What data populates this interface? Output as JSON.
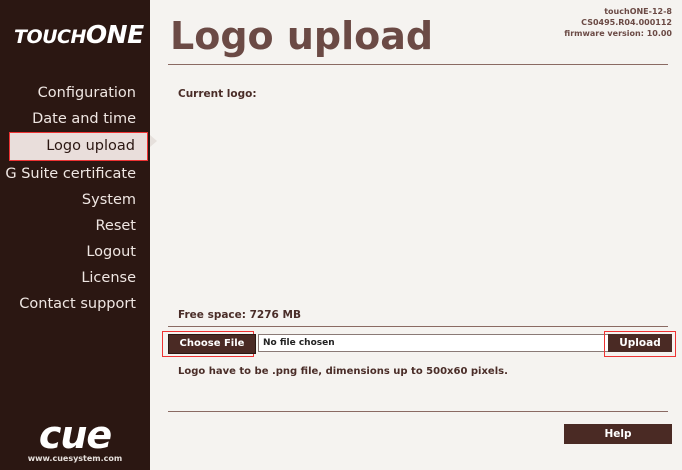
{
  "brand": {
    "logo_part1": "TOUCH",
    "logo_part2": "ONE",
    "footer_logo": "cue",
    "footer_url": "www.cuesystem.com"
  },
  "header": {
    "title": "Logo upload",
    "device_name": "touchONE-12-8",
    "serial": "CS0495.R04.000112",
    "firmware": "firmware version: 10.00"
  },
  "sidebar": {
    "items": [
      {
        "label": "Configuration"
      },
      {
        "label": "Date and time"
      },
      {
        "label": "Logo upload"
      },
      {
        "label": "G Suite certificate"
      },
      {
        "label": "System"
      },
      {
        "label": "Reset"
      },
      {
        "label": "Logout"
      },
      {
        "label": "License"
      },
      {
        "label": "Contact support"
      }
    ],
    "active_index": 2
  },
  "main": {
    "current_logo_label": "Current logo:",
    "free_space": "Free space: 7276 MB",
    "choose_file_label": "Choose File",
    "file_status": "No file chosen",
    "upload_label": "Upload",
    "note": "Logo have to be .png file, dimensions up to 500x60 pixels.",
    "help_label": "Help"
  },
  "colors": {
    "sidebar_bg": "#2b1712",
    "accent": "#4a2a24",
    "title": "#6b4a45",
    "highlight": "#ee3333"
  }
}
